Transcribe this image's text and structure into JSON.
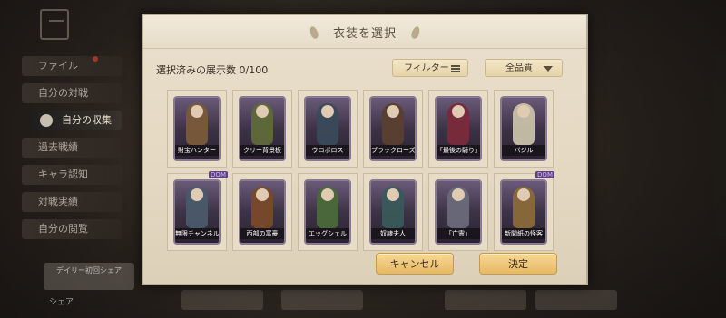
{
  "modal": {
    "title": "衣装を選択",
    "count_label": "選択済みの展示数 0/100",
    "filter_label": "フィルター",
    "quality_label": "全品質",
    "cancel_label": "キャンセル",
    "confirm_label": "決定"
  },
  "costumes": [
    {
      "label": "財宝ハンター",
      "color": "#7a5a3a"
    },
    {
      "label": "クリー背景板",
      "color": "#5e6a3a"
    },
    {
      "label": "ウロボロス",
      "color": "#3a4a5a"
    },
    {
      "label": "ブラックローズ",
      "color": "#5a4030"
    },
    {
      "label": "「最後の騎り」",
      "color": "#7a2a3a"
    },
    {
      "label": "バジル",
      "color": "#c8c0a8"
    },
    {
      "label": "無限チャンネル",
      "color": "#4a5a6a",
      "badge": "DOM"
    },
    {
      "label": "西部の富豪",
      "color": "#7a4a2a"
    },
    {
      "label": "エッグシェル",
      "color": "#4a6a3a"
    },
    {
      "label": "奴隷夫人",
      "color": "#3a5a5a"
    },
    {
      "label": "「亡霊」",
      "color": "#6a6a7a"
    },
    {
      "label": "新聞紙の怪客",
      "color": "#8a6a3a",
      "badge": "DOM"
    }
  ],
  "background": {
    "menu": [
      "ファイル",
      "自分の対戦",
      "自分の収集",
      "過去戦績",
      "キャラ認知",
      "対戦実績",
      "自分の閲覧"
    ],
    "active_index": 2,
    "daily_share": "デイリー初回シェア",
    "share": "シェア"
  }
}
